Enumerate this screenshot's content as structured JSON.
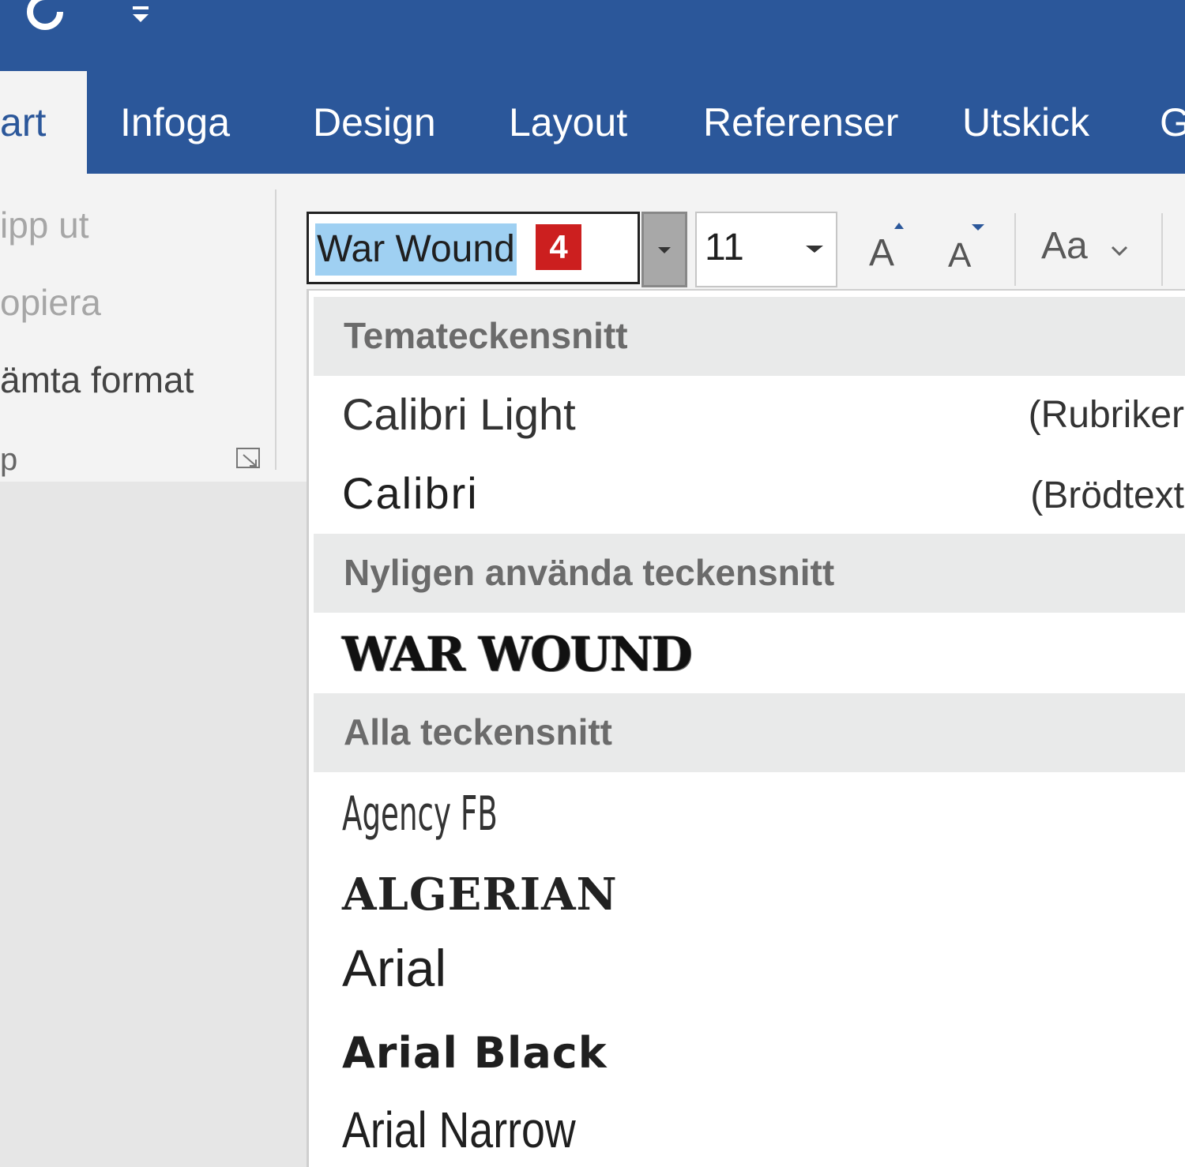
{
  "ribbon_tabs": {
    "active": "art",
    "items": [
      "Infoga",
      "Design",
      "Layout",
      "Referenser",
      "Utskick",
      "G"
    ]
  },
  "clipboard": {
    "cut": "ipp ut",
    "copy": "opiera",
    "format_painter": "ämta format",
    "group_label": "p"
  },
  "font": {
    "name": "War Wound",
    "badge": "4",
    "size": "11",
    "change_case": "Aa"
  },
  "dropdown": {
    "theme_header": "Temateckensnitt",
    "theme_fonts": [
      {
        "name": "Calibri Light",
        "tag": "(Rubriker"
      },
      {
        "name": "Calibri",
        "tag": "(Brödtext"
      }
    ],
    "recent_header": "Nyligen använda teckensnitt",
    "recent_fonts": [
      "WAR WOUND"
    ],
    "all_header": "Alla teckensnitt",
    "all_fonts": [
      "Agency FB",
      "ALGERIAN",
      "Arial",
      "Arial Black",
      "Arial Narrow"
    ]
  },
  "colors": {
    "ribbon_blue": "#2b579a",
    "selection": "#9fd0f2",
    "badge": "#cc1f1f"
  }
}
